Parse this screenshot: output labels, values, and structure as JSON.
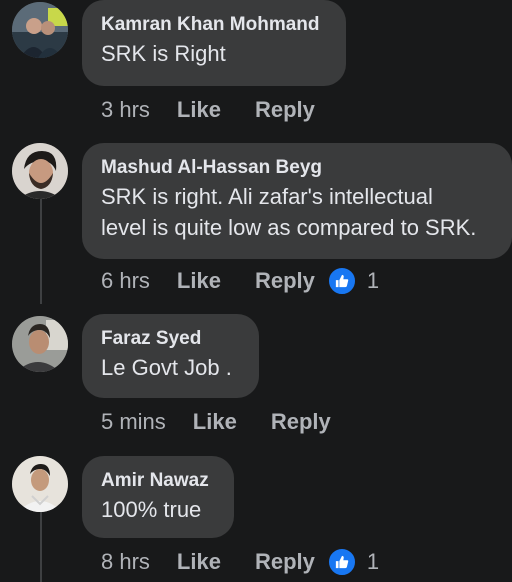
{
  "comments": [
    {
      "author": "Kamran Khan Mohmand",
      "text": "SRK is Right",
      "time": "3 hrs",
      "like_label": "Like",
      "reply_label": "Reply",
      "avatar_icon": "profile-photo-icon"
    },
    {
      "author": "Mashud Al-Hassan Beyg",
      "text_lines": [
        "SRK is right. Ali zafar's intellectual",
        "level is quite low as compared to SRK."
      ],
      "time": "6 hrs",
      "like_label": "Like",
      "reply_label": "Reply",
      "reaction_icon": "thumbs-up-icon",
      "reaction_count": "1",
      "avatar_icon": "profile-photo-icon"
    },
    {
      "author": "Faraz Syed",
      "text": "Le Govt Job .",
      "time": "5 mins",
      "like_label": "Like",
      "reply_label": "Reply",
      "avatar_icon": "profile-photo-icon"
    },
    {
      "author": "Amir Nawaz",
      "text": "100% true",
      "time": "8 hrs",
      "like_label": "Like",
      "reply_label": "Reply",
      "reaction_icon": "thumbs-up-icon",
      "reaction_count": "1",
      "avatar_icon": "profile-photo-icon"
    }
  ],
  "colors": {
    "background": "#18191a",
    "bubble": "#3a3b3c",
    "primary_text": "#e4e6eb",
    "secondary_text": "#b0b3b8",
    "like_reaction": "#1877f2"
  }
}
